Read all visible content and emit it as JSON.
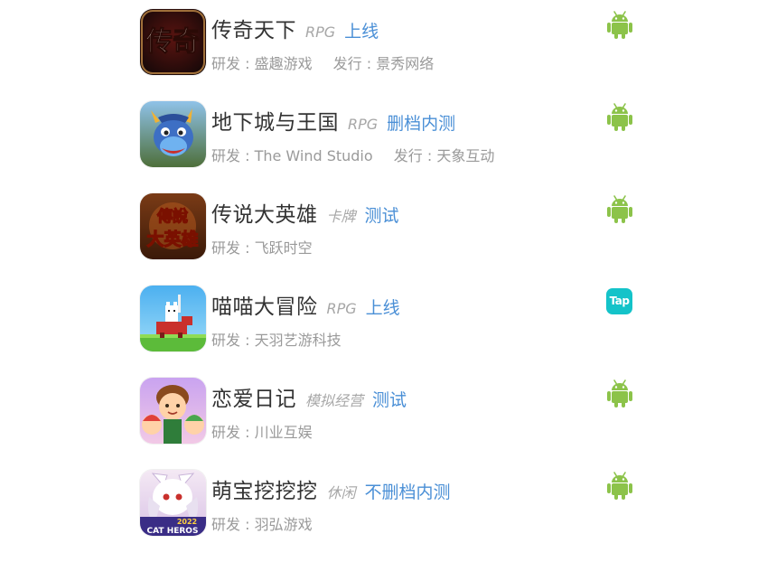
{
  "games": [
    {
      "name": "传奇天下",
      "genre": "RPG",
      "status": "上线",
      "developer": "研发 : 盛趣游戏",
      "publisher": "发行 : 景秀网络",
      "platform": "android-icon",
      "icon_text": "传奇"
    },
    {
      "name": "地下城与王国",
      "genre": "RPG",
      "status": "删档内测",
      "developer": "研发 : The Wind Studio",
      "publisher": "发行 : 天象互动",
      "platform": "android-icon",
      "icon_text": ""
    },
    {
      "name": "传说大英雄",
      "genre": "卡牌",
      "status": "测试",
      "developer": "研发 : 飞跃时空",
      "publisher": "",
      "platform": "android-icon",
      "icon_text": "傳說大英雄"
    },
    {
      "name": "喵喵大冒险",
      "genre": "RPG",
      "status": "上线",
      "developer": "研发 : 天羽艺游科技",
      "publisher": "",
      "platform": "taptap-icon",
      "platform_label": "Tap",
      "icon_text": ""
    },
    {
      "name": "恋爱日记",
      "genre": "模拟经营",
      "status": "测试",
      "developer": "研发 : 川业互娱",
      "publisher": "",
      "platform": "android-icon",
      "icon_text": ""
    },
    {
      "name": "萌宝挖挖挖",
      "genre": "休闲",
      "status": "不删档内测",
      "developer": "研发 : 羽弘游戏",
      "publisher": "",
      "platform": "android-icon",
      "icon_text": "CAT HEROS 2022"
    }
  ],
  "colors": {
    "name": "#333333",
    "genre": "#a7a7a7",
    "status": "#4a8fd6",
    "subtext": "#9a9a9a",
    "android": "#8cc34a",
    "taptap": "#14c3c9"
  }
}
